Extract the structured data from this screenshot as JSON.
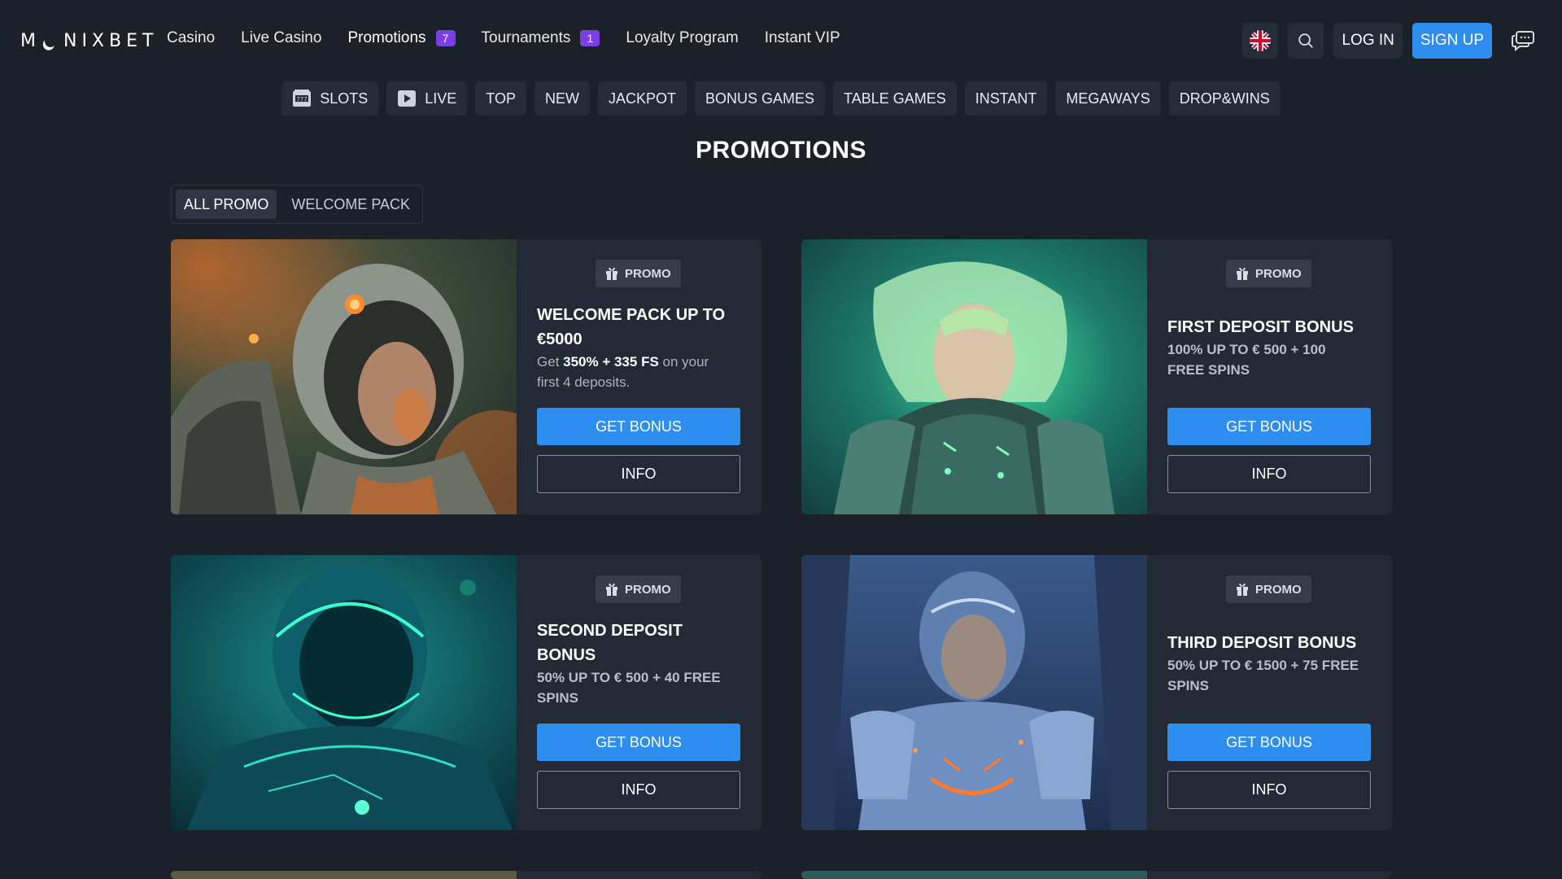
{
  "header": {
    "logo_left": "M",
    "logo_right": "NIXBET",
    "nav": [
      {
        "label": "Casino"
      },
      {
        "label": "Live Casino"
      },
      {
        "label": "Promotions",
        "badge": "7"
      },
      {
        "label": "Tournaments",
        "badge": "1"
      },
      {
        "label": "Loyalty Program"
      },
      {
        "label": "Instant VIP"
      }
    ],
    "login_label": "LOG IN",
    "signup_label": "SIGN UP"
  },
  "categories": [
    "SLOTS",
    "LIVE",
    "TOP",
    "NEW",
    "JACKPOT",
    "BONUS GAMES",
    "TABLE GAMES",
    "INSTANT",
    "MEGAWAYS",
    "DROP&WINS"
  ],
  "page": {
    "title": "PROMOTIONS",
    "tabs": [
      "ALL PROMO",
      "WELCOME PACK"
    ]
  },
  "promos": [
    {
      "tag": "PROMO",
      "title_lines": [
        "WELCOME PACK UP TO",
        "€5000"
      ],
      "desc_parts": [
        "Get ",
        "350% + 335 FS",
        " on your",
        "first 4 deposits."
      ],
      "bonus_label": "GET BONUS",
      "info_label": "INFO"
    },
    {
      "tag": "PROMO",
      "title_lines": [
        "FIRST DEPOSIT BONUS"
      ],
      "sub_lines": [
        "100% UP TO € 500 + 100",
        "FREE SPINS"
      ],
      "bonus_label": "GET BONUS",
      "info_label": "INFO"
    },
    {
      "tag": "PROMO",
      "title_lines": [
        "SECOND DEPOSIT",
        "BONUS"
      ],
      "sub_lines": [
        "50% UP TO € 500 + 40 FREE",
        "SPINS"
      ],
      "bonus_label": "GET BONUS",
      "info_label": "INFO"
    },
    {
      "tag": "PROMO",
      "title_lines": [
        "THIRD DEPOSIT BONUS"
      ],
      "sub_lines": [
        "50% UP TO € 1500 + 75 FREE",
        "SPINS"
      ],
      "bonus_label": "GET BONUS",
      "info_label": "INFO"
    }
  ],
  "colors": {
    "background": "#1b2029",
    "card": "#242a35",
    "accent": "#2d8ef0",
    "badge": "#7b3fe4"
  }
}
